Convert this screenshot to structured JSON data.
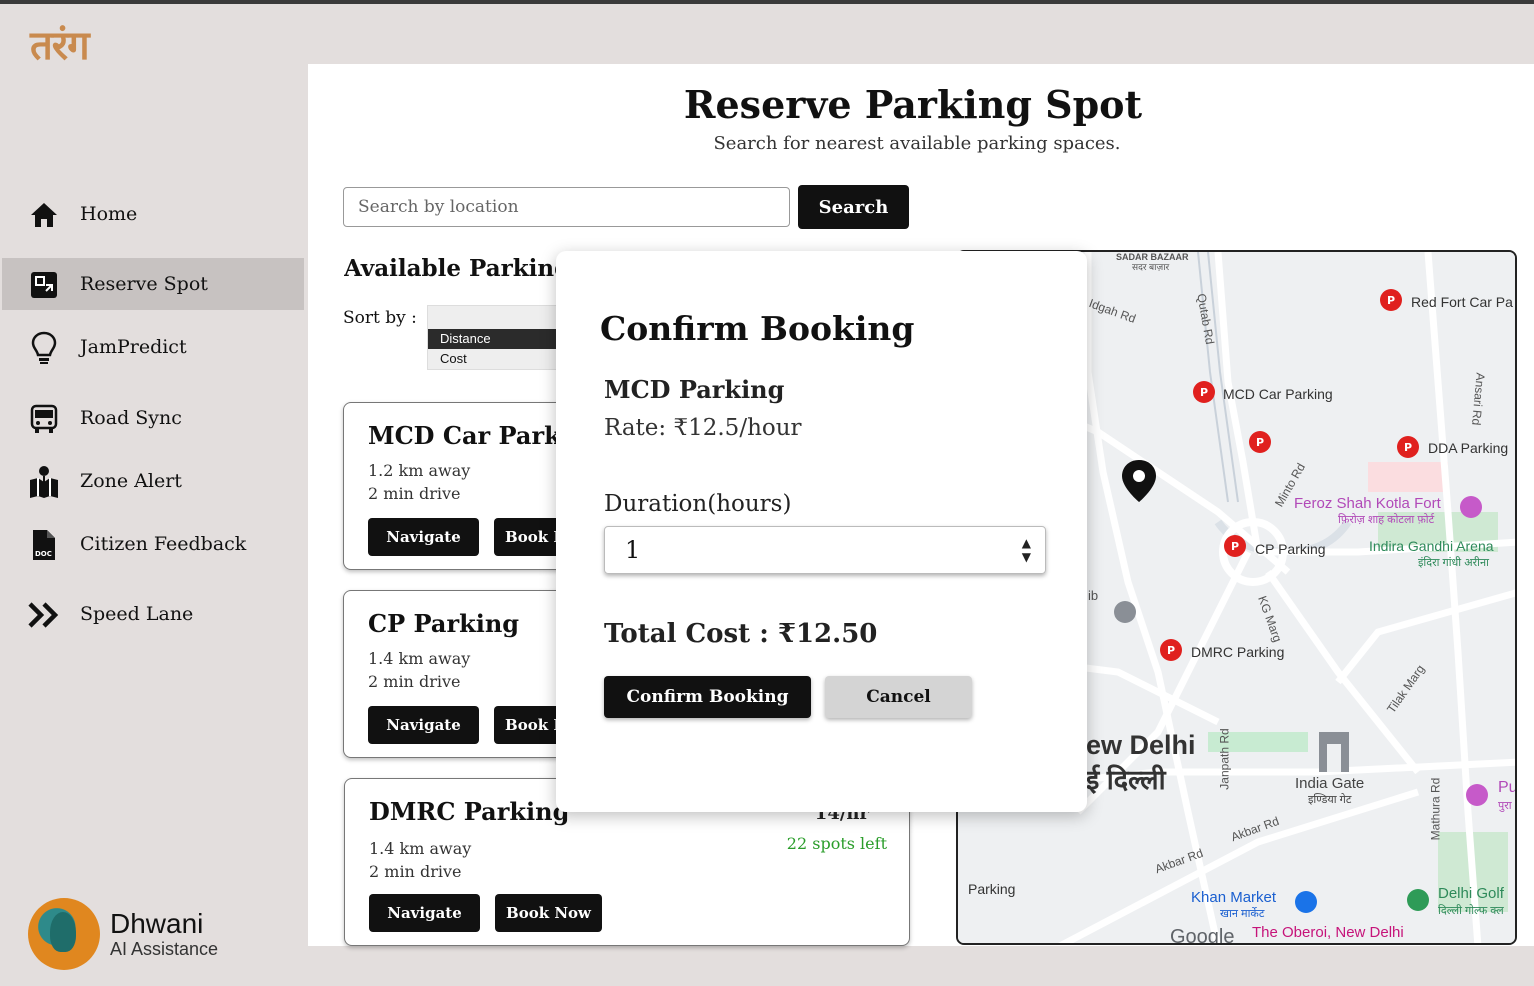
{
  "app": {
    "logo_text": "तरंग"
  },
  "sidebar": {
    "items": [
      {
        "label": "Home",
        "icon": "home-icon"
      },
      {
        "label": "Reserve Spot",
        "icon": "reserve-icon",
        "active": true
      },
      {
        "label": "JamPredict",
        "icon": "lightbulb-icon"
      },
      {
        "label": "Road Sync",
        "icon": "bus-icon"
      },
      {
        "label": "Zone Alert",
        "icon": "map-pin-icon"
      },
      {
        "label": "Citizen Feedback",
        "icon": "document-icon"
      },
      {
        "label": "Speed Lane",
        "icon": "double-chevron-icon"
      }
    ],
    "assistant": {
      "name": "Dhwani",
      "subtitle": "AI Assistance"
    }
  },
  "page": {
    "title": "Reserve Parking Spot",
    "subtitle": "Search for nearest available parking spaces.",
    "search_placeholder": "Search by location",
    "search_button": "Search",
    "available_title": "Available Parking Spots",
    "sort_label": "Sort by :",
    "sort_options": [
      "Distance",
      "Cost"
    ],
    "sort_selected": "Distance"
  },
  "cards": [
    {
      "name": "MCD Car Parking",
      "distance": "1.2 km away",
      "time": "2 min drive",
      "rate": "",
      "spots": "",
      "navigate": "Navigate",
      "book": "Book Now"
    },
    {
      "name": "CP Parking",
      "distance": "1.4 km away",
      "time": "2 min drive",
      "rate": "",
      "spots": "",
      "navigate": "Navigate",
      "book": "Book Now"
    },
    {
      "name": "DMRC Parking",
      "distance": "1.4 km away",
      "time": "2 min drive",
      "rate": "14/hr",
      "spots": "22 spots left",
      "navigate": "Navigate",
      "book": "Book Now"
    }
  ],
  "map": {
    "labels": {
      "sadar": "SADAR BAZAAR",
      "sadar_hi": "सदर बाज़ार",
      "idgah": "Idgah Rd",
      "qutab": "Qutab Rd",
      "red_fort": "Red Fort Car Pa",
      "mcd": "MCD Car Parking",
      "ansari": "Ansari Rd",
      "dda": "DDA Parking",
      "minto": "Minto Rd",
      "feroz": "Feroz Shah Kotla Fort",
      "feroz_hi": "फ़िरोज़ शाह कोटला फ़ोर्ट",
      "cp": "CP Parking",
      "indira": "Indira Gandhi Arena",
      "indira_hi": "इंदिरा गांधी अरीना",
      "kg": "KG Marg",
      "dmrc": "DMRC Parking",
      "tilak": "Tilak Marg",
      "newdelhi": "ew Delhi",
      "newdelhi_hi": "ई दिल्ली",
      "janpath": "Janpath Rd",
      "indiagate": "India Gate",
      "indiagate_hi": "इण्डिया गेट",
      "mathura": "Mathura Rd",
      "akbar1": "Akbar Rd",
      "akbar2": "Akbar Rd",
      "parking": "Parking",
      "khan": "Khan Market",
      "khan_hi": "खान मार्केट",
      "delhigolf": "Delhi Golf",
      "delhigolf_hi": "दिल्ली गोल्फ क्ल",
      "google": "Google",
      "oberoi": "The Oberoi, New Delhi",
      "pu": "Pu",
      "pu_hi": "पुरा",
      "ib": "ib"
    }
  },
  "modal": {
    "title": "Confirm Booking",
    "parking_name": "MCD Parking",
    "rate": "Rate:  ₹12.5/hour",
    "duration_label": "Duration(hours)",
    "duration_value": "1",
    "total_cost": "Total Cost :  ₹12.50",
    "confirm_button": "Confirm Booking",
    "cancel_button": "Cancel"
  }
}
